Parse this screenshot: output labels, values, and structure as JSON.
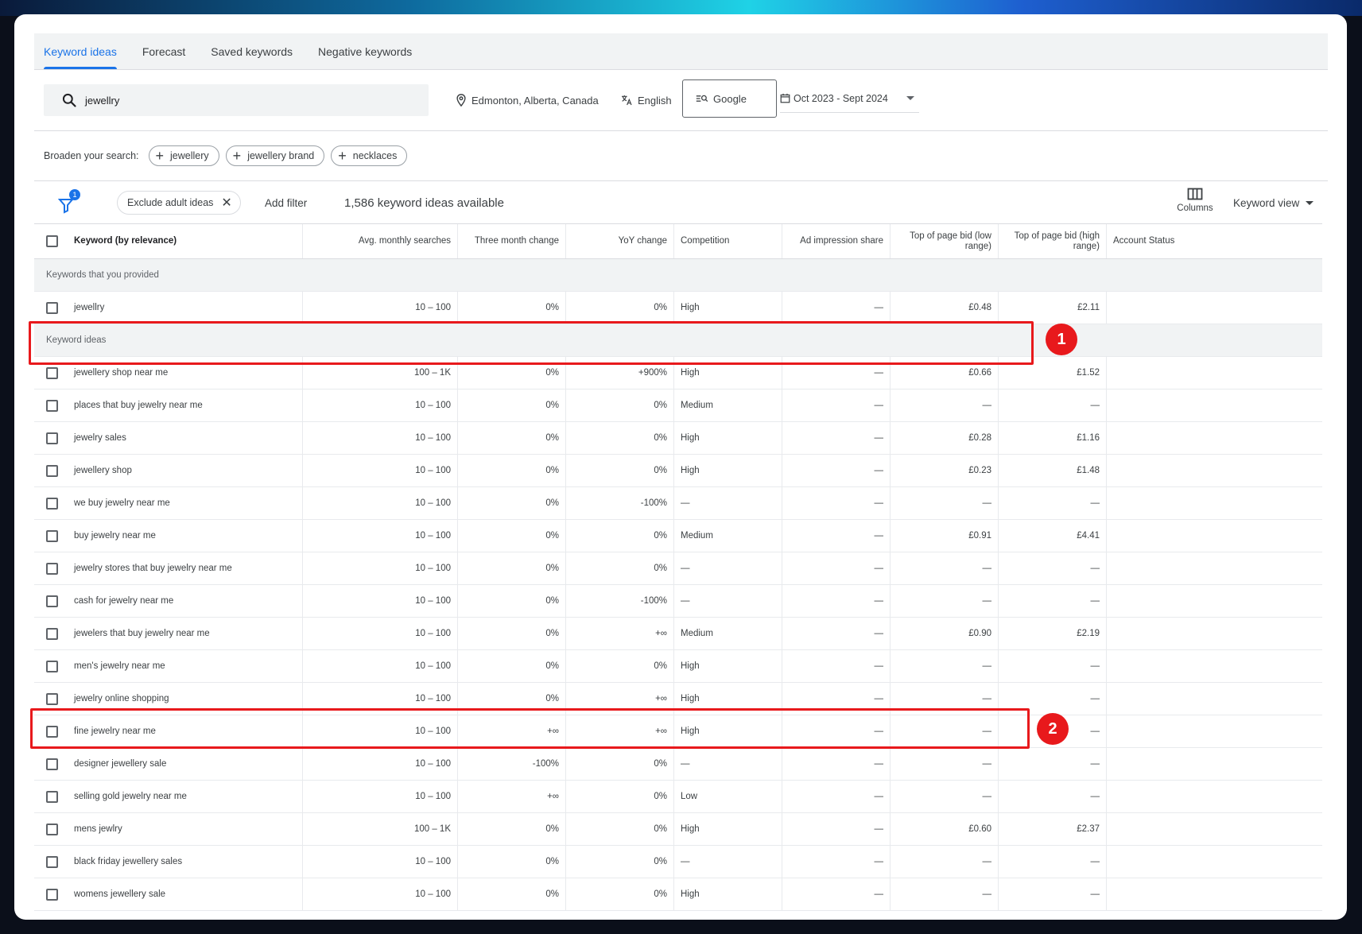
{
  "tabs": [
    {
      "label": "Keyword ideas",
      "active": true
    },
    {
      "label": "Forecast",
      "active": false
    },
    {
      "label": "Saved keywords",
      "active": false
    },
    {
      "label": "Negative keywords",
      "active": false
    }
  ],
  "search": {
    "value": "jewellry"
  },
  "location": "Edmonton, Alberta, Canada",
  "language": "English",
  "network": "Google",
  "date_range": "Oct 2023 - Sept 2024",
  "broaden": {
    "label": "Broaden your search:",
    "chips": [
      "jewellery",
      "jewellery brand",
      "necklaces"
    ]
  },
  "toolbar": {
    "filter_count": "1",
    "exclude_chip": "Exclude adult ideas",
    "add_filter": "Add filter",
    "ideas_count": "1,586 keyword ideas available",
    "columns": "Columns",
    "keyword_view": "Keyword view"
  },
  "table": {
    "headers": {
      "keyword": "Keyword (by relevance)",
      "avg": "Avg. monthly searches",
      "three_month": "Three month change",
      "yoy": "YoY change",
      "competition": "Competition",
      "impression": "Ad impression share",
      "bid_low": "Top of page bid (low range)",
      "bid_high": "Top of page bid (high range)",
      "account": "Account Status"
    },
    "provided_label": "Keywords that you provided",
    "provided": [
      {
        "keyword": "jewellry",
        "avg": "10 – 100",
        "three_month": "0%",
        "yoy": "0%",
        "competition": "High",
        "impression": "—",
        "bid_low": "£0.48",
        "bid_high": "£2.11"
      }
    ],
    "ideas_label": "Keyword ideas",
    "ideas": [
      {
        "keyword": "jewellery shop near me",
        "avg": "100 – 1K",
        "three_month": "0%",
        "yoy": "+900%",
        "competition": "High",
        "impression": "—",
        "bid_low": "£0.66",
        "bid_high": "£1.52"
      },
      {
        "keyword": "places that buy jewelry near me",
        "avg": "10 – 100",
        "three_month": "0%",
        "yoy": "0%",
        "competition": "Medium",
        "impression": "—",
        "bid_low": "—",
        "bid_high": "—"
      },
      {
        "keyword": "jewelry sales",
        "avg": "10 – 100",
        "three_month": "0%",
        "yoy": "0%",
        "competition": "High",
        "impression": "—",
        "bid_low": "£0.28",
        "bid_high": "£1.16"
      },
      {
        "keyword": "jewellery shop",
        "avg": "10 – 100",
        "three_month": "0%",
        "yoy": "0%",
        "competition": "High",
        "impression": "—",
        "bid_low": "£0.23",
        "bid_high": "£1.48"
      },
      {
        "keyword": "we buy jewelry near me",
        "avg": "10 – 100",
        "three_month": "0%",
        "yoy": "-100%",
        "competition": "—",
        "impression": "—",
        "bid_low": "—",
        "bid_high": "—"
      },
      {
        "keyword": "buy jewelry near me",
        "avg": "10 – 100",
        "three_month": "0%",
        "yoy": "0%",
        "competition": "Medium",
        "impression": "—",
        "bid_low": "£0.91",
        "bid_high": "£4.41"
      },
      {
        "keyword": "jewelry stores that buy jewelry near me",
        "avg": "10 – 100",
        "three_month": "0%",
        "yoy": "0%",
        "competition": "—",
        "impression": "—",
        "bid_low": "—",
        "bid_high": "—"
      },
      {
        "keyword": "cash for jewelry near me",
        "avg": "10 – 100",
        "three_month": "0%",
        "yoy": "-100%",
        "competition": "—",
        "impression": "—",
        "bid_low": "—",
        "bid_high": "—"
      },
      {
        "keyword": "jewelers that buy jewelry near me",
        "avg": "10 – 100",
        "three_month": "0%",
        "yoy": "+∞",
        "competition": "Medium",
        "impression": "—",
        "bid_low": "£0.90",
        "bid_high": "£2.19"
      },
      {
        "keyword": "men's jewelry near me",
        "avg": "10 – 100",
        "three_month": "0%",
        "yoy": "0%",
        "competition": "High",
        "impression": "—",
        "bid_low": "—",
        "bid_high": "—"
      },
      {
        "keyword": "jewelry online shopping",
        "avg": "10 – 100",
        "three_month": "0%",
        "yoy": "+∞",
        "competition": "High",
        "impression": "—",
        "bid_low": "—",
        "bid_high": "—"
      },
      {
        "keyword": "fine jewelry near me",
        "avg": "10 – 100",
        "three_month": "+∞",
        "yoy": "+∞",
        "competition": "High",
        "impression": "—",
        "bid_low": "—",
        "bid_high": "—"
      },
      {
        "keyword": "designer jewellery sale",
        "avg": "10 – 100",
        "three_month": "-100%",
        "yoy": "0%",
        "competition": "—",
        "impression": "—",
        "bid_low": "—",
        "bid_high": "—"
      },
      {
        "keyword": "selling gold jewelry near me",
        "avg": "10 – 100",
        "three_month": "+∞",
        "yoy": "0%",
        "competition": "Low",
        "impression": "—",
        "bid_low": "—",
        "bid_high": "—"
      },
      {
        "keyword": "mens jewlry",
        "avg": "100 – 1K",
        "three_month": "0%",
        "yoy": "0%",
        "competition": "High",
        "impression": "—",
        "bid_low": "£0.60",
        "bid_high": "£2.37"
      },
      {
        "keyword": "black friday jewellery sales",
        "avg": "10 – 100",
        "three_month": "0%",
        "yoy": "0%",
        "competition": "—",
        "impression": "—",
        "bid_low": "—",
        "bid_high": "—"
      },
      {
        "keyword": "womens jewellery sale",
        "avg": "10 – 100",
        "three_month": "0%",
        "yoy": "0%",
        "competition": "High",
        "impression": "—",
        "bid_low": "—",
        "bid_high": "—"
      }
    ]
  },
  "annotations": [
    {
      "label": "1"
    },
    {
      "label": "2"
    }
  ],
  "colors": {
    "accent": "#1a73e8",
    "highlight": "#e8191c"
  }
}
